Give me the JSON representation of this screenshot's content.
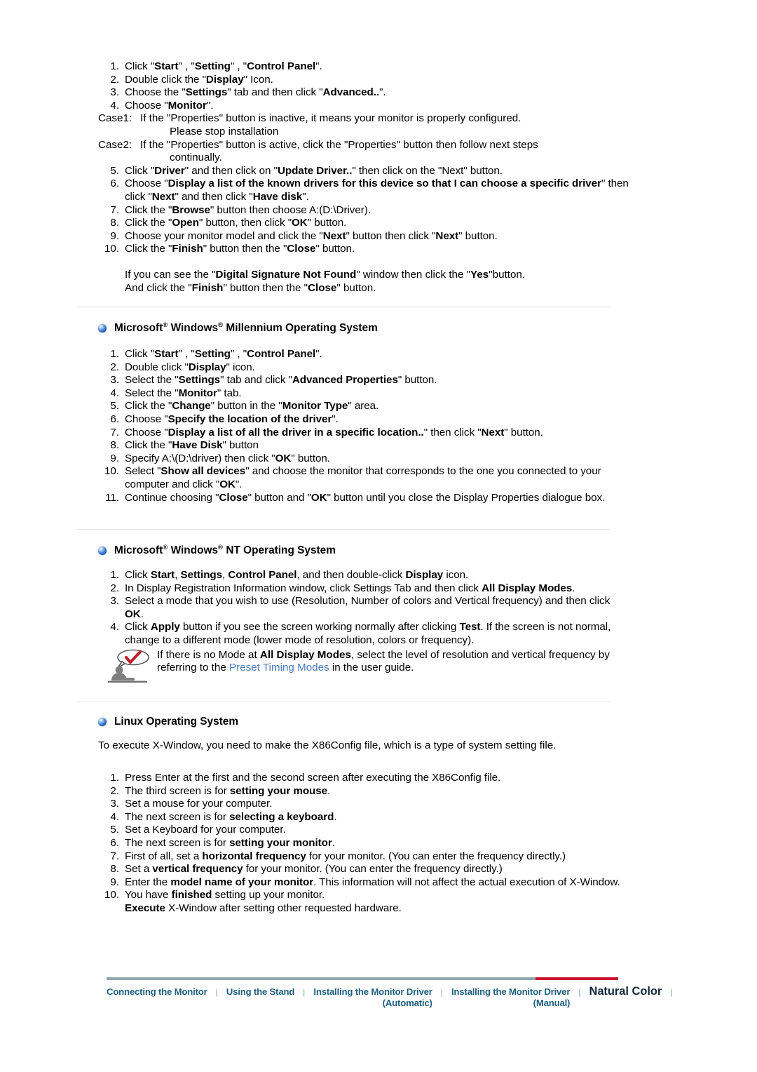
{
  "win2k_steps": [
    {
      "num": "1.",
      "html": "Click \"<b>Start</b>\" , \"<b>Setting</b>\" , \"<b>Control Panel</b>\"."
    },
    {
      "num": "2.",
      "html": "Double click the \"<b>Display</b>\" Icon."
    },
    {
      "num": "3.",
      "html": "Choose the \"<b>Settings</b>\" tab and then click \"<b>Advanced..</b>\"."
    },
    {
      "num": "4.",
      "html": "Choose \"<b>Monitor</b>\"."
    }
  ],
  "cases": [
    {
      "label": "Case1:",
      "text": "If the \"Properties\" button is inactive, it means your monitor is properly configured.",
      "cont": "Please stop installation"
    },
    {
      "label": "Case2:",
      "text": "If the \"Properties\" button is active, click the \"Properties\" button then follow next steps",
      "cont": "continually."
    }
  ],
  "win2k_steps_b": [
    {
      "num": "5.",
      "html": "Click \"<b>Driver</b>\" and then click on \"<b>Update Driver..</b>\" then click on the \"Next\" button."
    },
    {
      "num": "6.",
      "html": "Choose \"<b>Display a list of the known drivers for this device so that I can choose a specific driver</b>\" then click \"<b>Next</b>\" and then click \"<b>Have disk</b>\"."
    },
    {
      "num": "7.",
      "html": "Click the \"<b>Browse</b>\" button then choose A:(D:\\Driver)."
    },
    {
      "num": "8.",
      "html": "Click the \"<b>Open</b>\" button, then click \"<b>OK</b>\" button."
    },
    {
      "num": "9.",
      "html": "Choose your monitor model and click the \"<b>Next</b>\" button then click \"<b>Next</b>\" button."
    },
    {
      "num": "10.",
      "html": "Click the \"<b>Finish</b>\" button then the \"<b>Close</b>\" button."
    }
  ],
  "win2k_note": {
    "line1": "If you can see the \"<b>Digital Signature Not Found</b>\" window then click the \"<b>Yes</b>\"button.",
    "line2": "And click the \"<b>Finish</b>\" button then the \"<b>Close</b>\" button."
  },
  "millennium": {
    "title_html": "Microsoft<sup>®</sup> Windows<sup>®</sup> Millennium Operating System",
    "steps": [
      {
        "num": "1.",
        "html": "Click \"<b>Start</b>\" , \"<b>Setting</b>\" , \"<b>Control Panel</b>\"."
      },
      {
        "num": "2.",
        "html": "Double click \"<b>Display</b>\" icon."
      },
      {
        "num": "3.",
        "html": "Select the \"<b>Settings</b>\" tab and click \"<b>Advanced Properties</b>\" button."
      },
      {
        "num": "4.",
        "html": "Select the \"<b>Monitor</b>\" tab."
      },
      {
        "num": "5.",
        "html": "Click the \"<b>Change</b>\" button in the \"<b>Monitor Type</b>\" area."
      },
      {
        "num": "6.",
        "html": "Choose \"<b>Specify the location of the driver</b>\"."
      },
      {
        "num": "7.",
        "html": "Choose \"<b>Display a list of all the driver in a specific location..</b>\" then click \"<b>Next</b>\" button."
      },
      {
        "num": "8.",
        "html": "Click the \"<b>Have Disk</b>\" button"
      },
      {
        "num": "9.",
        "html": "Specify A:\\(D:\\driver) then click \"<b>OK</b>\" button."
      },
      {
        "num": "10.",
        "html": "Select \"<b>Show all devices</b>\" and choose the monitor that corresponds to the one you connected to your computer and click \"<b>OK</b>\"."
      },
      {
        "num": "11.",
        "html": "Continue choosing \"<b>Close</b>\" button and \"<b>OK</b>\" button until you close the Display Properties dialogue box."
      }
    ]
  },
  "nt": {
    "title_html": "Microsoft<sup>®</sup> Windows<sup>®</sup> NT Operating System",
    "steps": [
      {
        "num": "1.",
        "html": "Click <b>Start</b>, <b>Settings</b>, <b>Control Panel</b>, and then double-click <b>Display</b> icon."
      },
      {
        "num": "2.",
        "html": "In Display Registration Information window, click Settings Tab and then click <b>All Display Modes</b>."
      },
      {
        "num": "3.",
        "html": "Select a mode that you wish to use (Resolution, Number of colors and Vertical frequency) and then click <b>OK</b>."
      },
      {
        "num": "4.",
        "html": "Click <b>Apply</b> button if you see the screen working normally after clicking <b>Test</b>. If the screen is not normal, change to a different mode (lower mode of resolution, colors or frequency)."
      }
    ],
    "tip_html": "If there is no Mode at <b>All Display Modes</b>, select the level of resolution and vertical frequency by referring to the <span class=\"link-blue\">Preset Timing Modes</span> in the user guide.",
    "tip_link_text": "Preset Timing Modes"
  },
  "linux": {
    "title_html": "Linux Operating System",
    "intro": "To execute X-Window, you need to make the X86Config file, which is a type of system setting file.",
    "steps": [
      {
        "num": "1.",
        "html": "Press Enter at the first and the second screen after executing the X86Config file."
      },
      {
        "num": "2.",
        "html": "The third screen is for <b>setting your mouse</b>."
      },
      {
        "num": "3.",
        "html": "Set a mouse for your computer."
      },
      {
        "num": "4.",
        "html": "The next screen is for <b>selecting a keyboard</b>."
      },
      {
        "num": "5.",
        "html": "Set a Keyboard for your computer."
      },
      {
        "num": "6.",
        "html": "The next screen is for <b>setting your monitor</b>."
      },
      {
        "num": "7.",
        "html": "First of all, set a <b>horizontal frequency</b> for your monitor. (You can enter the frequency directly.)"
      },
      {
        "num": "8.",
        "html": "Set a <b>vertical frequency</b> for your monitor. (You can enter the frequency directly.)"
      },
      {
        "num": "9.",
        "html": "Enter the <b>model name of your monitor</b>. This information will not affect the actual execution of X-Window."
      },
      {
        "num": "10.",
        "html": "You have <b>finished</b> setting up your monitor.<br><b>Execute</b> X-Window after setting other requested hardware."
      }
    ]
  },
  "footer": {
    "items": [
      {
        "label": "Connecting  the Monitor",
        "accent": false,
        "lines": [
          "Connecting  the Monitor"
        ]
      },
      {
        "label": "Using the Stand",
        "accent": false,
        "lines": [
          "Using the Stand"
        ]
      },
      {
        "label": "Installing the Monitor Driver (Automatic)",
        "accent": false,
        "lines": [
          "Installing the Monitor Driver",
          "(Automatic)"
        ]
      },
      {
        "label": "Installing the Monitor Driver (Manual)",
        "accent": false,
        "lines": [
          "Installing the Monitor Driver",
          "(Manual)"
        ]
      },
      {
        "label": "Natural Color",
        "accent": true,
        "lines": [
          "Natural Color"
        ]
      }
    ],
    "separator": "❘",
    "link_color": "#1f6080",
    "accent_color": "#12263a",
    "rule_color": "#8ea7ad",
    "red_color": "#c8102e"
  }
}
